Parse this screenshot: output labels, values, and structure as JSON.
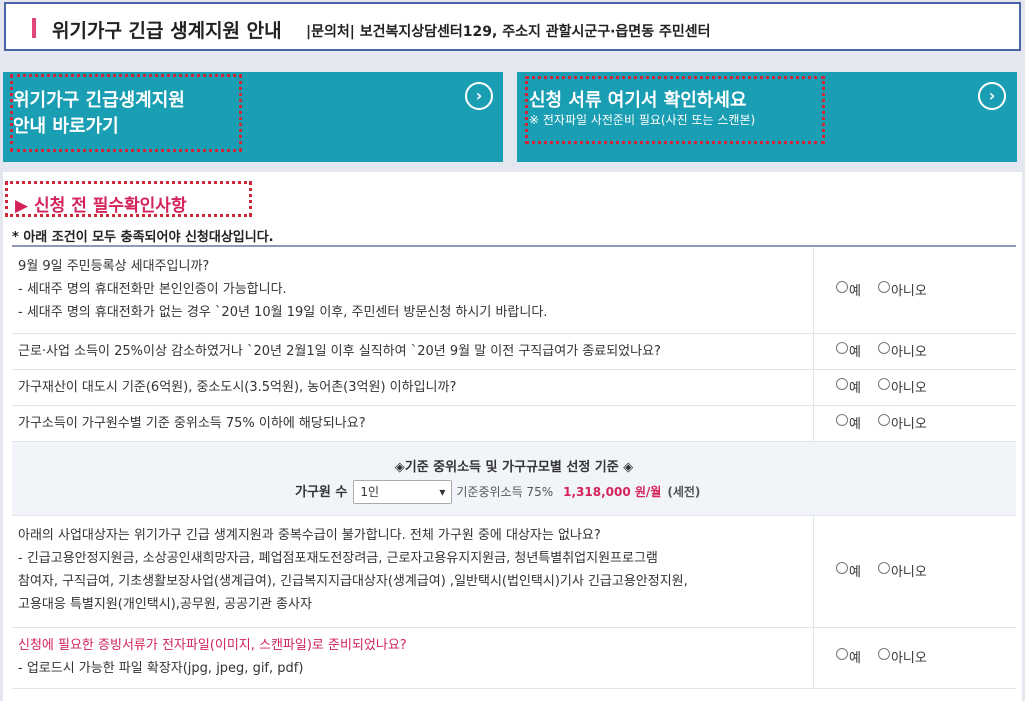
{
  "header": {
    "title": "위기가구 긴급 생계지원 안내",
    "contact": "|문의처| 보건복지상담센터129, 주소지 관할시군구·읍면동 주민센터"
  },
  "buttons": {
    "guide_line1": "위기가구 긴급생계지원",
    "guide_line2": "안내 바로가기",
    "docs_title": "신청 서류 여기서 확인하세요",
    "docs_sub": "※ 전자파일 사전준비 필요(사진 또는 스캔본)",
    "arrow_glyph": "›"
  },
  "checklist": {
    "title": "▶ 신청 전 필수확인사항",
    "condition": "* 아래 조건이 모두 충족되어야 신청대상입니다.",
    "yes": "예",
    "no": "아니오",
    "q1": {
      "l1": "9월 9일 주민등록상 세대주입니까?",
      "l2": "- 세대주 명의 휴대전화만 본인인증이 가능합니다.",
      "l3": "- 세대주 명의 휴대전화가 없는 경우 `20년 10월 19일 이후, 주민센터 방문신청 하시기 바랍니다."
    },
    "q2": "근로·사업 소득이 25%이상 감소하였거나 `20년 2월1일 이후 실직하여 `20년 9월 말 이전 구직급여가 종료되었나요?",
    "q3": "가구재산이 대도시 기준(6억원), 중소도시(3.5억원), 농어촌(3억원) 이하입니까?",
    "q4": "가구소득이 가구원수별 기준 중위소득 75% 이하에 해당되나요?",
    "income": {
      "title": "◈기준 중위소득 및 가구규모별 선정 기준 ◈",
      "household_label": "가구원 수",
      "household_value": "1인",
      "median_label": "기준중위소득 75%",
      "amount": "1,318,000 원/월",
      "pretax": "(세전)"
    },
    "q5": {
      "l1": "아래의 사업대상자는 위기가구 긴급 생계지원과 중복수급이 불가합니다. 전체 가구원 중에 대상자는 없나요?",
      "l2": "- 긴급고용안정지원금, 소상공인새희망자금, 폐업점포재도전장려금, 근로자고용유지지원금, 청년특별취업지원프로그램",
      "l3": "참여자, 구직급여, 기초생활보장사업(생계급여), 긴급복지지급대상자(생계급여) ,일반택시(법인택시)기사 긴급고용안정지원,",
      "l4": "고용대응 특별지원(개인택시),공무원, 공공기관 종사자"
    },
    "q6": {
      "l1": "신청에 필요한 증빙서류가 전자파일(이미지, 스캔파일)로 준비되었나요?",
      "l2": "- 업로드시 가능한 파일 확장자(jpg, jpeg, gif, pdf)"
    }
  }
}
